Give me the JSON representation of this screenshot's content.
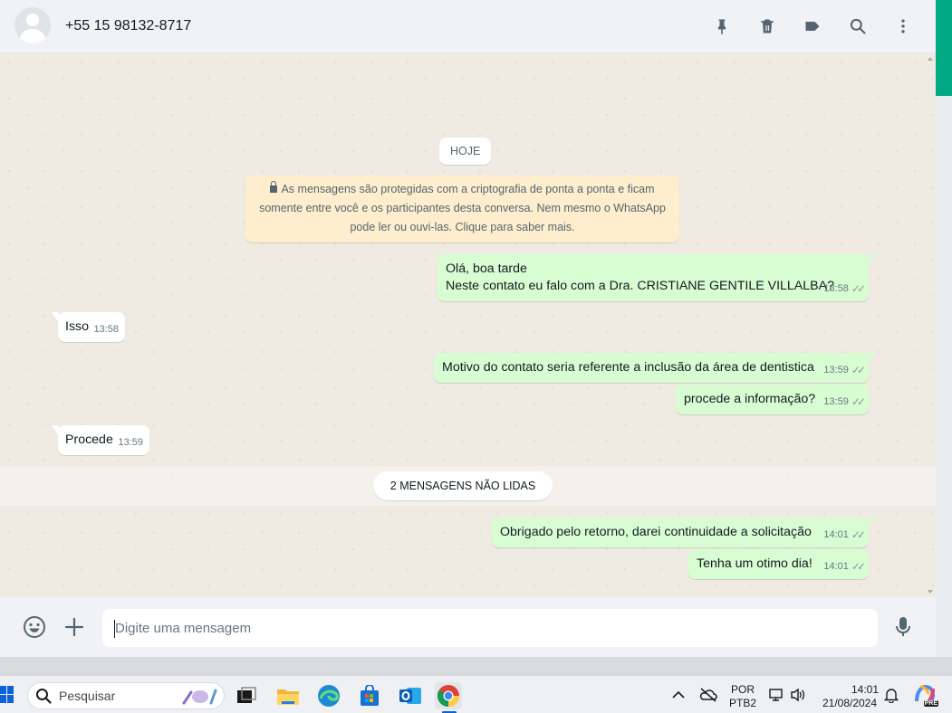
{
  "header": {
    "contact_name": "+55 15 98132-8717",
    "icons": [
      "pin-icon",
      "trash-icon",
      "label-icon",
      "search-icon",
      "more-vertical-icon"
    ]
  },
  "chat": {
    "date_chip": "HOJE",
    "encryption_notice": {
      "line1": "As mensagens são protegidas com a criptografia de ponta a ponta e ficam",
      "line2": "somente entre você e os participantes desta conversa. Nem mesmo o WhatsApp",
      "line3": "pode ler ou ouvi-las. Clique para saber mais."
    },
    "messages": [
      {
        "direction": "out",
        "line1": "Olá, boa tarde",
        "line2": "Neste contato eu falo com a  Dra. CRISTIANE GENTILE VILLALBA?",
        "time": "13:58"
      },
      {
        "direction": "in",
        "text": "Isso",
        "time": "13:58"
      },
      {
        "direction": "out",
        "text": "Motivo do contato seria referente a inclusão da área de dentistica",
        "time": "13:59"
      },
      {
        "direction": "out",
        "text": "procede a informação?",
        "time": "13:59"
      },
      {
        "direction": "in",
        "text": "Procede",
        "time": "13:59"
      },
      {
        "direction": "out",
        "text": "Obrigado pelo retorno, darei continuidade a solicitação",
        "time": "14:01"
      },
      {
        "direction": "out",
        "text": "Tenha um otimo dia!",
        "time": "14:01"
      }
    ],
    "unread_divider": "2 MENSAGENS NÃO LIDAS"
  },
  "composer": {
    "placeholder": "Digite uma mensagem",
    "value": ""
  },
  "taskbar": {
    "search_placeholder": "Pesquisar",
    "language_line1": "POR",
    "language_line2": "PTB2",
    "clock_time": "14:01",
    "clock_date": "21/08/2024",
    "copilot_badge": "PRE"
  },
  "colors": {
    "outgoing_bubble": "#d9fdd3",
    "incoming_bubble": "#ffffff",
    "chat_background": "#efeae2",
    "accent": "#00a884",
    "notice_background": "#ffeecd"
  }
}
